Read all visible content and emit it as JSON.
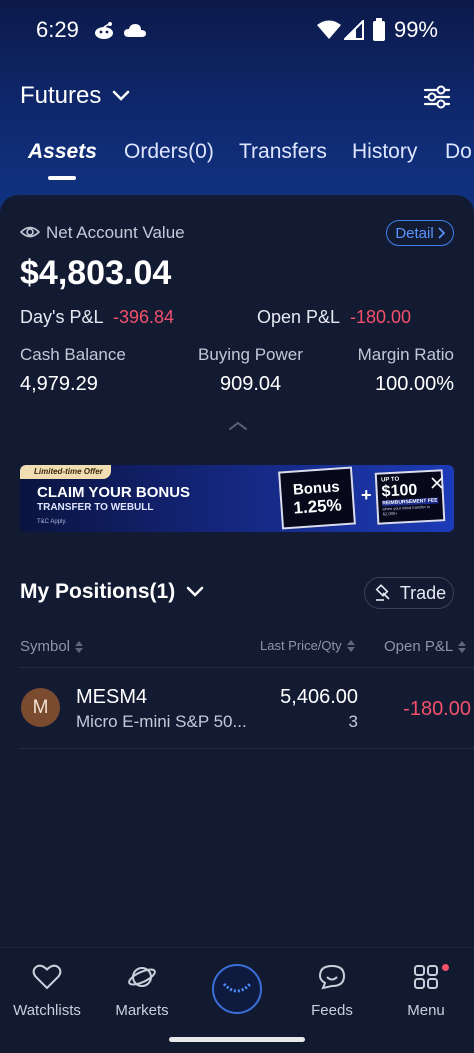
{
  "status_bar": {
    "time": "6:29",
    "battery": "99%"
  },
  "header": {
    "title": "Futures"
  },
  "tabs": [
    {
      "label": "Assets"
    },
    {
      "label": "Orders(0)"
    },
    {
      "label": "Transfers"
    },
    {
      "label": "History"
    },
    {
      "label": "Do"
    }
  ],
  "account": {
    "net_label": "Net Account Value",
    "detail_label": "Detail",
    "net_value": "$4,803.04",
    "days_pl_label": "Day's P&L",
    "days_pl_value": "-396.84",
    "open_pl_label": "Open P&L",
    "open_pl_value": "-180.00",
    "cash_label": "Cash Balance",
    "cash_value": "4,979.29",
    "buying_label": "Buying Power",
    "buying_value": "909.04",
    "margin_label": "Margin Ratio",
    "margin_value": "100.00%"
  },
  "banner": {
    "tag": "Limited-time Offer",
    "title": "CLAIM YOUR BONUS",
    "subtitle": "TRANSFER TO WEBULL",
    "tc": "T&C Apply.",
    "bonus_line1": "Bonus",
    "bonus_line2": "1.25%",
    "plus": "+",
    "reimb_upto": "UP TO",
    "reimb_amount": "$100",
    "reimb_label": "REIMBURSEMENT FEE",
    "reimb_note": "when your initial transfer is $2,000+"
  },
  "positions": {
    "title": "My Positions(1)",
    "trade_label": "Trade",
    "columns": {
      "symbol": "Symbol",
      "last_price": "Last Price/Qty",
      "open_pl": "Open P&L"
    },
    "rows": [
      {
        "avatar": "M",
        "symbol": "MESM4",
        "description": "Micro E-mini S&P 50...",
        "last_price": "5,406.00",
        "qty": "3",
        "open_pl": "-180.00"
      }
    ]
  },
  "bottom_nav": [
    {
      "label": "Watchlists",
      "icon": "heart-icon"
    },
    {
      "label": "Markets",
      "icon": "planet-icon"
    },
    {
      "label": "",
      "icon": "home-smile-icon"
    },
    {
      "label": "Feeds",
      "icon": "chat-smile-icon"
    },
    {
      "label": "Menu",
      "icon": "grid-icon"
    }
  ],
  "colors": {
    "negative": "#f2506b",
    "positive": "#2fd59a",
    "accent": "#3f7fe8"
  }
}
